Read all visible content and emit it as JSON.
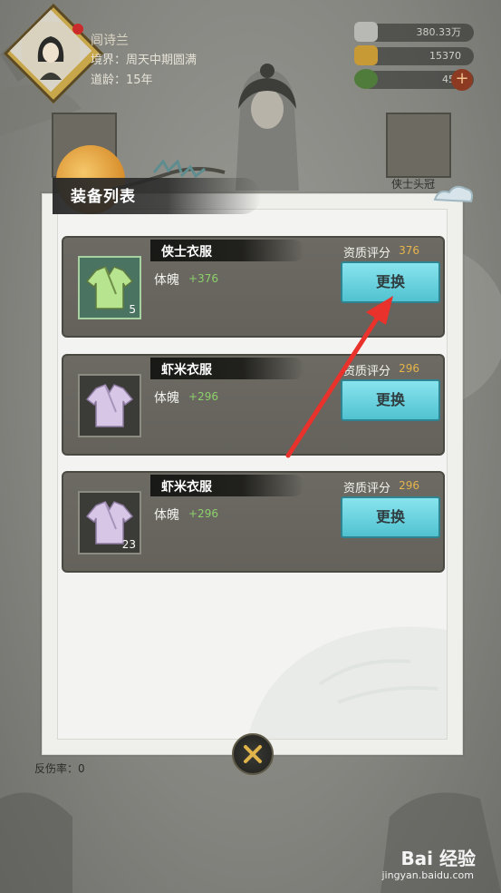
{
  "hud": {
    "character_name": "闾诗兰",
    "realm": "境界：周天中期圆满",
    "age": "道龄：15年",
    "silver": "380.33万",
    "gold": "15370",
    "jade": "450"
  },
  "slots": {
    "right_slot_label": "侠士头冠"
  },
  "dialog": {
    "title": "装备列表",
    "items": [
      {
        "name": "侠士衣服",
        "score_label": "资质评分",
        "score": "376",
        "stat_label": "体魄",
        "stat_value": "+376",
        "count": "5",
        "button": "更换",
        "icon_color": "#b6e48f"
      },
      {
        "name": "虾米衣服",
        "score_label": "资质评分",
        "score": "296",
        "stat_label": "体魄",
        "stat_value": "+296",
        "count": "",
        "button": "更换",
        "icon_color": "#d8c6e6"
      },
      {
        "name": "虾米衣服",
        "score_label": "资质评分",
        "score": "296",
        "stat_label": "体魄",
        "stat_value": "+296",
        "count": "23",
        "button": "更换",
        "icon_color": "#d8c6e6"
      }
    ]
  },
  "background_text": {
    "bottom_row": "反伤率：0"
  },
  "watermark": {
    "brand": "Bai 经验",
    "url": "jingyan.baidu.com"
  },
  "colors": {
    "button": "#5fc9d6",
    "score": "#e6b44c",
    "stat": "#8cd06a",
    "arrow": "#e8322b"
  }
}
